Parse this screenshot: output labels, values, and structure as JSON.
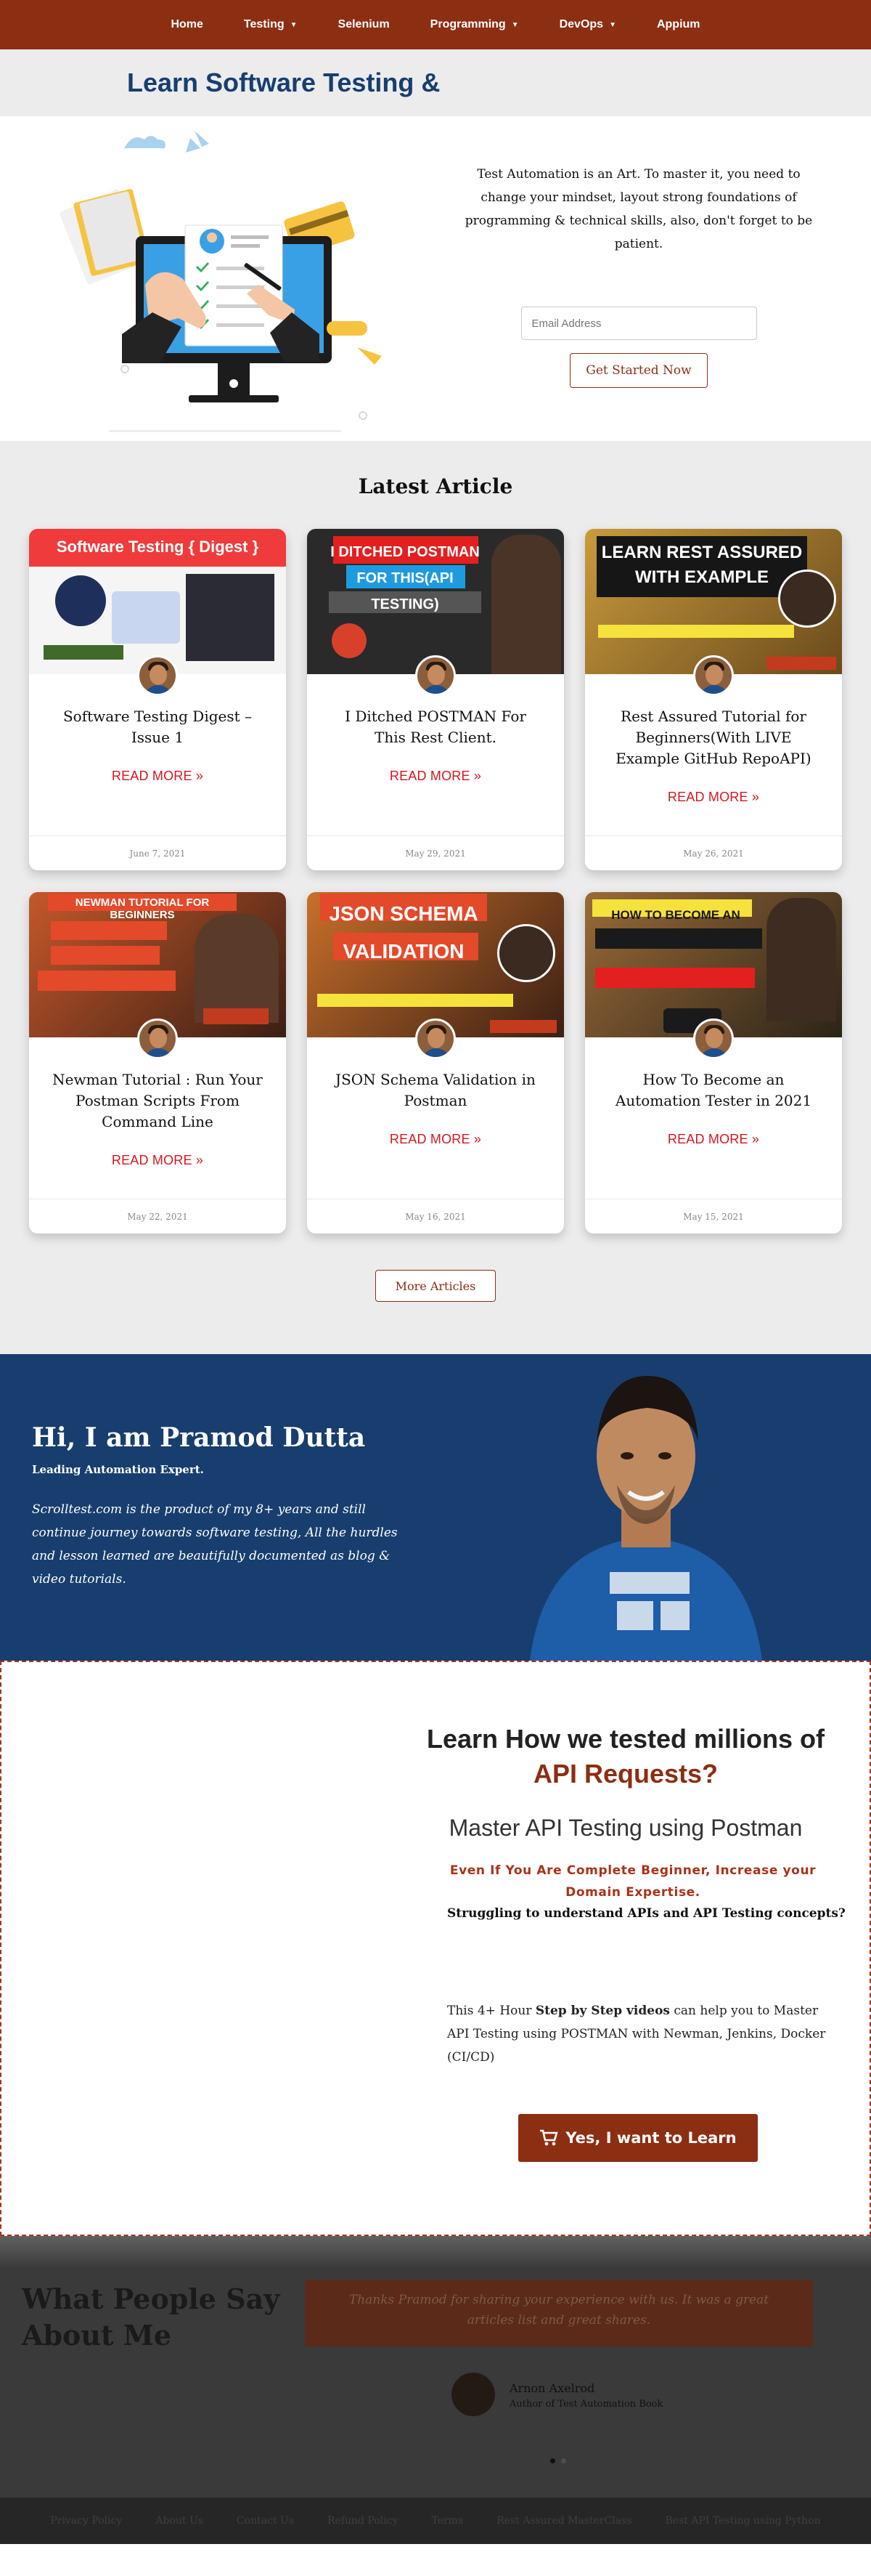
{
  "nav": {
    "items": [
      {
        "label": "Home",
        "dropdown": false
      },
      {
        "label": "Testing",
        "dropdown": true
      },
      {
        "label": "Selenium",
        "dropdown": false
      },
      {
        "label": "Programming",
        "dropdown": true
      },
      {
        "label": "DevOps",
        "dropdown": true
      },
      {
        "label": "Appium",
        "dropdown": false
      }
    ],
    "caret": "⌄"
  },
  "hero": {
    "title": "Learn Software Testing &",
    "intro": "Test Automation is an Art. To master it, you need to change your mindset, layout strong foundations of programming & technical skills, also, don't forget to be patient.",
    "email_placeholder": "Email Address",
    "cta": "Get Started Now"
  },
  "articles": {
    "heading": "Latest Article",
    "more_label": "READ MORE »",
    "items": [
      {
        "title": "Software Testing Digest – Issue 1",
        "date": "June 7, 2021",
        "thumb": "Software Testing { Digest }"
      },
      {
        "title": "I Ditched POSTMAN For This Rest Client.",
        "date": "May 29, 2021",
        "thumb": "I DITCHED POSTMAN FOR THIS(API TESTING)"
      },
      {
        "title": "Rest Assured Tutorial for Beginners(With LIVE Example GitHub RepoAPI)",
        "date": "May 26, 2021",
        "thumb": "LEARN REST ASSURED WITH EXAMPLE"
      },
      {
        "title": "Newman Tutorial : Run Your Postman Scripts From Command Line",
        "date": "May 22, 2021",
        "thumb": "NEWMAN TUTORIAL FOR BEGINNERS"
      },
      {
        "title": "JSON Schema Validation in Postman",
        "date": "May 16, 2021",
        "thumb": "JSON SCHEMA VALIDATION"
      },
      {
        "title": "How To Become an Automation Tester in 2021",
        "date": "May 15, 2021",
        "thumb": "HOW TO BECOME AN AUTOMATION TESTER"
      }
    ],
    "more_articles": "More Articles"
  },
  "about": {
    "heading": "Hi, I am Pramod Dutta",
    "tagline": "Leading Automation Expert.",
    "bio": "Scrolltest.com is the product of my 8+ years and still continue journey towards software testing, All the hurdles and lesson learned are beautifully documented as blog & video tutorials."
  },
  "course": {
    "heading_a": "Learn How we tested millions of ",
    "heading_b": "API Requests?",
    "subheading": "Master API Testing using Postman",
    "red_line": "Even If You Are Complete Beginner, Increase your Domain Expertise.",
    "question": "Struggling to understand APIs and API Testing concepts?",
    "desc_a": "This 4+ Hour ",
    "desc_bold": "Step by Step videos",
    "desc_b": " can help you to Master API Testing using POSTMAN with Newman, Jenkins, Docker (CI/CD)",
    "cta": "Yes, I want to Learn"
  },
  "testimonial": {
    "heading_line1": "What People Say",
    "heading_line2": "About Me",
    "quote": "Thanks Pramod for sharing your experience with us. It was a great articles list and great shares.",
    "name": "Arnon Axelrod",
    "role": "Author of Test Automation Book"
  },
  "footer": {
    "links": [
      "Privacy Policy",
      "About Us",
      "Contact Us",
      "Refund Policy",
      "Terms",
      "Rest Assured MasterClass",
      "Best API Testing using Python"
    ]
  },
  "colors": {
    "brand": "#8c2e12",
    "navy": "#173e6e",
    "read_more": "#d6161d"
  }
}
